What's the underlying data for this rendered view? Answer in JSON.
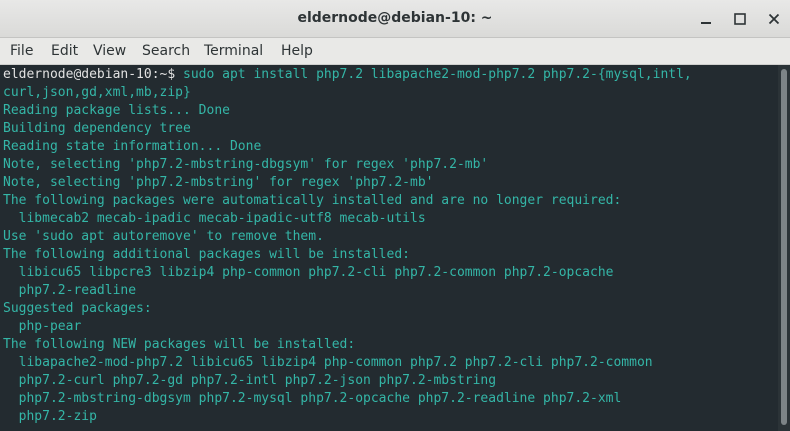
{
  "window": {
    "title": "eldernode@debian-10: ~",
    "buttons": [
      "minimize-icon",
      "maximize-icon",
      "close-icon"
    ]
  },
  "menubar": {
    "items": [
      "File",
      "Edit",
      "View",
      "Search",
      "Terminal",
      "Help"
    ]
  },
  "terminal": {
    "colors": {
      "background": "#232b30",
      "text": "#34b6a7",
      "prompt": "#e2e2e2"
    },
    "prompt": "eldernode@debian-10:~$ ",
    "command": "sudo apt install php7.2 libapache2-mod-php7.2 php7.2-{mysql,intl,",
    "lines": [
      "curl,json,gd,xml,mb,zip}",
      "Reading package lists... Done",
      "Building dependency tree",
      "Reading state information... Done",
      "Note, selecting 'php7.2-mbstring-dbgsym' for regex 'php7.2-mb'",
      "Note, selecting 'php7.2-mbstring' for regex 'php7.2-mb'",
      "The following packages were automatically installed and are no longer required:",
      "  libmecab2 mecab-ipadic mecab-ipadic-utf8 mecab-utils",
      "Use 'sudo apt autoremove' to remove them.",
      "The following additional packages will be installed:",
      "  libicu65 libpcre3 libzip4 php-common php7.2-cli php7.2-common php7.2-opcache",
      "  php7.2-readline",
      "Suggested packages:",
      "  php-pear",
      "The following NEW packages will be installed:",
      "  libapache2-mod-php7.2 libicu65 libzip4 php-common php7.2 php7.2-cli php7.2-common",
      "  php7.2-curl php7.2-gd php7.2-intl php7.2-json php7.2-mbstring",
      "  php7.2-mbstring-dbgsym php7.2-mysql php7.2-opcache php7.2-readline php7.2-xml",
      "  php7.2-zip"
    ]
  }
}
